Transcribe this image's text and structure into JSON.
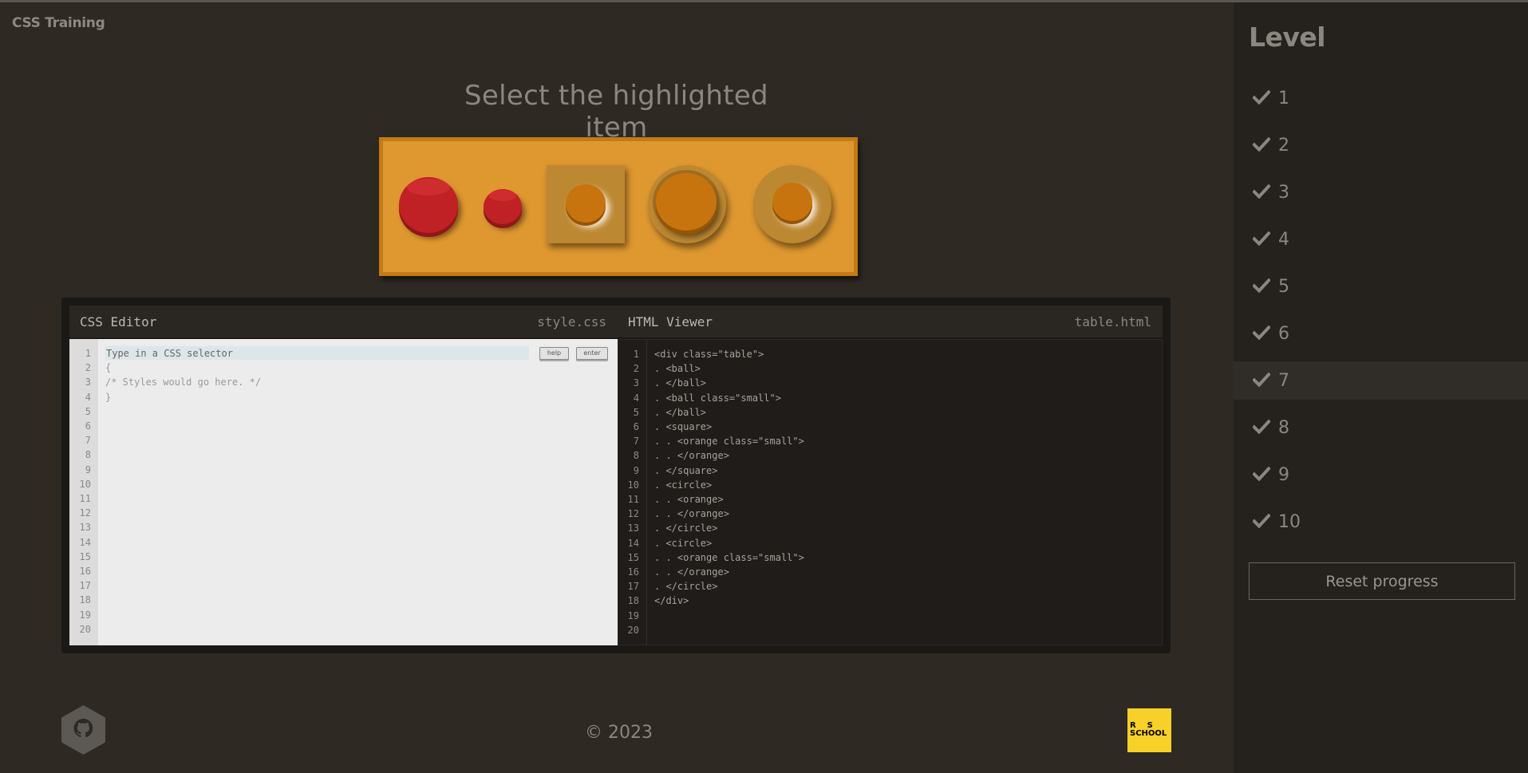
{
  "app": {
    "title": "CSS Training"
  },
  "instruction": "Select the highlighted item",
  "table": {
    "items": [
      {
        "type": "ball",
        "size": "large"
      },
      {
        "type": "ball",
        "size": "small"
      },
      {
        "type": "square",
        "child": "orange small"
      },
      {
        "type": "circle",
        "child": "orange"
      },
      {
        "type": "circle",
        "child": "orange small"
      }
    ]
  },
  "css_editor": {
    "title": "CSS Editor",
    "file": "style.css",
    "placeholder": "Type in a CSS selector",
    "lines": [
      "{",
      "/* Styles would go here. */",
      "}"
    ],
    "help_label": "help",
    "enter_label": "enter",
    "line_numbers": [
      "1",
      "2",
      "3",
      "4",
      "5",
      "6",
      "7",
      "8",
      "9",
      "10",
      "11",
      "12",
      "13",
      "14",
      "15",
      "16",
      "17",
      "18",
      "19",
      "20"
    ]
  },
  "html_viewer": {
    "title": "HTML Viewer",
    "file": "table.html",
    "lines": [
      "<div class=\"table\">",
      ". <ball>",
      ". </ball>",
      ". <ball class=\"small\">",
      ". </ball>",
      ". <square>",
      ". . <orange class=\"small\">",
      ". . </orange>",
      ". </square>",
      ". <circle>",
      ". . <orange>",
      ". . </orange>",
      ". </circle>",
      ". <circle>",
      ". . <orange class=\"small\">",
      ". . </orange>",
      ". </circle>",
      "</div>"
    ],
    "line_numbers": [
      "1",
      "2",
      "3",
      "4",
      "5",
      "6",
      "7",
      "8",
      "9",
      "10",
      "11",
      "12",
      "13",
      "14",
      "15",
      "16",
      "17",
      "18",
      "19",
      "20"
    ]
  },
  "footer": {
    "copyright": "© 2023",
    "rs_logo_text": "RS SCHOOL"
  },
  "sidebar": {
    "title": "Level",
    "levels": [
      {
        "label": "1",
        "completed": true
      },
      {
        "label": "2",
        "completed": true
      },
      {
        "label": "3",
        "completed": true
      },
      {
        "label": "4",
        "completed": true
      },
      {
        "label": "5",
        "completed": true
      },
      {
        "label": "6",
        "completed": true
      },
      {
        "label": "7",
        "completed": true,
        "active": true
      },
      {
        "label": "8",
        "completed": true
      },
      {
        "label": "9",
        "completed": true
      },
      {
        "label": "10",
        "completed": true
      }
    ],
    "reset_label": "Reset progress"
  },
  "colors": {
    "background": "#2e2923",
    "sidebar": "#25221e",
    "table": "#df9830",
    "ball": "#bf2125",
    "orange": "#c8740e",
    "rs_logo": "#f7d02a"
  }
}
